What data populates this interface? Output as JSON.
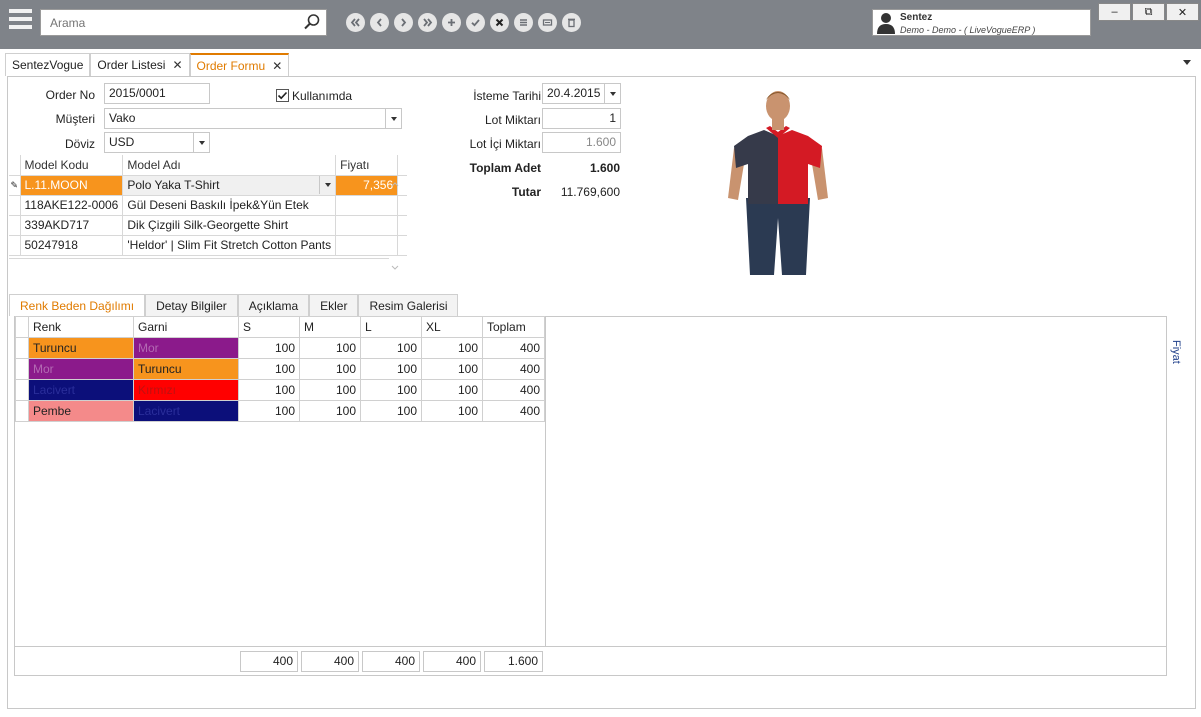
{
  "search": {
    "placeholder": "Arama"
  },
  "user": {
    "name": "Sentez",
    "subtitle": "Demo - Demo - ( LiveVogueERP )"
  },
  "window_controls": {
    "minimize": "‒",
    "restore": "⧉",
    "close": "✕"
  },
  "toolbar": {
    "icons": [
      "first-icon",
      "previous-icon",
      "next-icon",
      "last-icon",
      "add-icon",
      "confirm-icon",
      "cancel-icon",
      "list-icon",
      "print-icon",
      "delete-icon"
    ]
  },
  "tabs": [
    {
      "label": "SentezVogue",
      "closable": false,
      "active": false
    },
    {
      "label": "Order Listesi",
      "closable": true,
      "active": false
    },
    {
      "label": "Order Formu",
      "closable": true,
      "active": true
    }
  ],
  "form": {
    "order_no_label": "Order No",
    "order_no": "2015/0001",
    "kullanimda_label": "Kullanımda",
    "kullanimda_checked": true,
    "musteri_label": "Müşteri",
    "musteri": "Vako",
    "doviz_label": "Döviz",
    "doviz": "USD",
    "isteme_tarihi_label": "İsteme Tarihi",
    "isteme_tarihi": "20.4.2015",
    "lot_miktari_label": "Lot Miktarı",
    "lot_miktari": "1",
    "lot_ici_miktari_label": "Lot İçi Miktarı",
    "lot_ici_miktari": "1.600",
    "toplam_adet_label": "Toplam Adet",
    "toplam_adet": "1.600",
    "tutar_label": "Tutar",
    "tutar": "11.769,600"
  },
  "model_grid": {
    "headers": [
      "Model Kodu",
      "Model Adı",
      "Fiyatı"
    ],
    "rows": [
      {
        "code": "L.11.MOON",
        "name": "Polo Yaka T-Shirt",
        "price": "7,356"
      },
      {
        "code": "118AKE122-0006",
        "name": "Gül Deseni Baskılı İpek&Yün Etek",
        "price": ""
      },
      {
        "code": "339AKD717",
        "name": "Dik Çizgili Silk-Georgette Shirt",
        "price": ""
      },
      {
        "code": "50247918",
        "name": "'Heldor' | Slim Fit Stretch Cotton Pants",
        "price": ""
      }
    ]
  },
  "detail_tabs": [
    "Renk Beden Dağılımı",
    "Detay Bilgiler",
    "Açıklama",
    "Ekler",
    "Resim Galerisi"
  ],
  "side_label": "Fiyat",
  "renk_grid": {
    "headers": [
      "Renk",
      "Garni",
      "S",
      "M",
      "L",
      "XL",
      "Toplam"
    ],
    "rows": [
      {
        "renk": "Turuncu",
        "renk_bg": "#f7941d",
        "renk_fg": "#222222",
        "garni": "Mor",
        "garni_bg": "#8b1a8b",
        "garni_fg": "#b36ab3",
        "s": "100",
        "m": "100",
        "l": "100",
        "xl": "100",
        "toplam": "400"
      },
      {
        "renk": "Mor",
        "renk_bg": "#8b1a8b",
        "renk_fg": "#b36ab3",
        "garni": "Turuncu",
        "garni_bg": "#f7941d",
        "garni_fg": "#222222",
        "s": "100",
        "m": "100",
        "l": "100",
        "xl": "100",
        "toplam": "400"
      },
      {
        "renk": "Lacivert",
        "renk_bg": "#0c0f7a",
        "renk_fg": "#2a2e9a",
        "garni": "Kırmızı",
        "garni_bg": "#ff0000",
        "garni_fg": "#c01010",
        "s": "100",
        "m": "100",
        "l": "100",
        "xl": "100",
        "toplam": "400"
      },
      {
        "renk": "Pembe",
        "renk_bg": "#f48a8a",
        "renk_fg": "#222222",
        "garni": "Lacivert",
        "garni_bg": "#0c0f7a",
        "garni_fg": "#2a2e9a",
        "s": "100",
        "m": "100",
        "l": "100",
        "xl": "100",
        "toplam": "400"
      }
    ],
    "totals": {
      "s": "400",
      "m": "400",
      "l": "400",
      "xl": "400",
      "toplam": "1.600"
    }
  },
  "colors": {
    "accent": "#e07b00",
    "topbar": "#7f8389",
    "selected_cell": "#f7941d"
  }
}
